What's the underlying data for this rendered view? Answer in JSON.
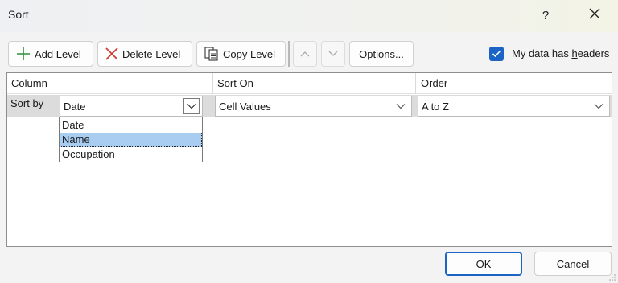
{
  "window": {
    "title": "Sort",
    "help_label": "?",
    "close_label": "✕"
  },
  "toolbar": {
    "add_level": {
      "prefix": "",
      "underline": "A",
      "rest": "dd Level"
    },
    "delete_level": {
      "underline": "D",
      "rest": "elete Level"
    },
    "copy_level": {
      "underline": "C",
      "rest": "opy Level"
    },
    "options": {
      "underline": "O",
      "rest": "ptions..."
    },
    "headers_checkbox": {
      "checked": true,
      "label_pre": "My data has ",
      "label_underline": "h",
      "label_rest": "eaders"
    }
  },
  "grid": {
    "headers": {
      "column": "Column",
      "sort_on": "Sort On",
      "order": "Order"
    },
    "rows": [
      {
        "label": "Sort by",
        "column": "Date",
        "sort_on": "Cell Values",
        "order": "A to Z"
      }
    ]
  },
  "dropdown": {
    "options": [
      "Date",
      "Name",
      "Occupation"
    ],
    "highlighted_index": 1
  },
  "buttons": {
    "ok": "OK",
    "cancel": "Cancel"
  },
  "colors": {
    "accent": "#1b63c4",
    "highlight": "#a8cdf0",
    "row_bg": "#dcdcdc"
  }
}
